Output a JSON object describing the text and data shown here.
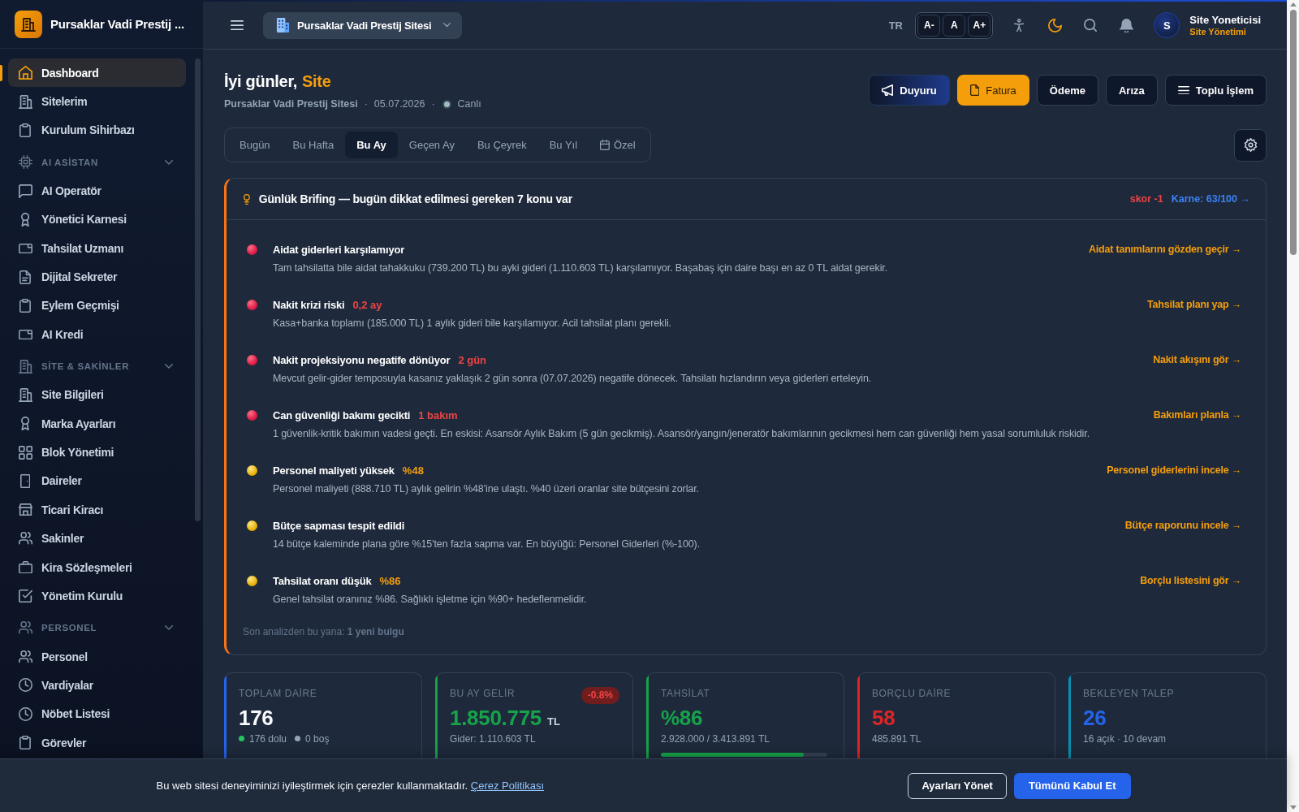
{
  "sidebar": {
    "brand": "Pursaklar Vadi Prestij ...",
    "nav": [
      {
        "kind": "link",
        "label": "Dashboard",
        "selected": true
      },
      {
        "kind": "link",
        "label": "Sitelerim",
        "selected": false
      },
      {
        "kind": "link",
        "label": "Kurulum Sihirbazı",
        "selected": false
      },
      {
        "kind": "group",
        "label": "AI ASİSTAN",
        "expanded": true,
        "children": [
          {
            "label": "AI Operatör",
            "selected": false
          },
          {
            "label": "Yönetici Karnesi",
            "selected": false
          },
          {
            "label": "Tahsilat Uzmanı",
            "selected": false
          },
          {
            "label": "Dijital Sekreter",
            "selected": false
          },
          {
            "label": "Eylem Geçmişi",
            "selected": false
          },
          {
            "label": "AI Kredi",
            "selected": false
          }
        ]
      },
      {
        "kind": "group",
        "label": "SİTE & SAKİNLER",
        "expanded": true,
        "children": [
          {
            "label": "Site Bilgileri",
            "selected": false
          },
          {
            "label": "Marka Ayarları",
            "selected": false
          },
          {
            "label": "Blok Yönetimi",
            "selected": false
          },
          {
            "label": "Daireler",
            "selected": false
          },
          {
            "label": "Ticari Kiracı",
            "selected": false
          },
          {
            "label": "Sakinler",
            "selected": false
          },
          {
            "label": "Kira Sözleşmeleri",
            "selected": false
          },
          {
            "label": "Yönetim Kurulu",
            "selected": false
          }
        ]
      },
      {
        "kind": "group",
        "label": "PERSONEL",
        "expanded": true,
        "children": [
          {
            "label": "Personel",
            "selected": false
          },
          {
            "label": "Vardiyalar",
            "selected": false
          },
          {
            "label": "Nöbet Listesi",
            "selected": false
          },
          {
            "label": "Görevler",
            "selected": false
          }
        ]
      }
    ]
  },
  "topbar": {
    "site_selector": "Pursaklar Vadi Prestij Sitesi",
    "language": "TR",
    "font_sizes": [
      "A-",
      "A",
      "A+"
    ],
    "user": {
      "initial": "S",
      "name": "Site Yoneticisi",
      "role": "Site Yönetimi"
    }
  },
  "page": {
    "greeting": "İyi günler,",
    "greeting_name": "Site",
    "meta": [
      {
        "kind": "site",
        "text": "Pursaklar Vadi Prestij Sitesi"
      },
      {
        "kind": "separator",
        "text": "·"
      },
      {
        "kind": "date",
        "text": "05.07.2026"
      },
      {
        "kind": "separator",
        "text": "·"
      },
      {
        "kind": "status",
        "text": "Canlı"
      }
    ],
    "actions": [
      {
        "label": "Duyuru",
        "kind": "accent"
      },
      {
        "label": "Fatura",
        "kind": "primary"
      },
      {
        "label": "Ödeme",
        "kind": "default"
      },
      {
        "label": "Arıza",
        "kind": "default"
      },
      {
        "label": "Toplu İşlem",
        "kind": "default"
      }
    ],
    "periods": [
      {
        "label": "Bugün",
        "selected": false
      },
      {
        "label": "Bu Hafta",
        "selected": false
      },
      {
        "label": "Bu Ay",
        "selected": true
      },
      {
        "label": "Geçen Ay",
        "selected": false
      },
      {
        "label": "Bu Çeyrek",
        "selected": false
      },
      {
        "label": "Bu Yıl",
        "selected": false
      },
      {
        "label": "Özel",
        "selected": false
      }
    ]
  },
  "briefing": {
    "title": "Günlük Brifing — bugün dikkat edilmesi gereken 7 konu var",
    "score": "skor -1",
    "report_card_link": "Karne: 63/100 →",
    "items": [
      {
        "kind": "critical",
        "title": "Aidat giderleri karşılamıyor",
        "description": "Tam tahsilatta bile aidat tahakkuku (739.200 TL) bu ayki gideri (1.110.603 TL) karşılamıyor. Başabaş için daire başı en az 0 TL aidat gerekir.",
        "action": "Aidat tanımlarını gözden geçir →"
      },
      {
        "kind": "critical",
        "title": "Nakit krizi riski",
        "tag": "0,2 ay",
        "description": "Kasa+banka toplamı (185.000 TL) 1 aylık gideri bile karşılamıyor. Acil tahsilat planı gerekli.",
        "action": "Tahsilat planı yap →"
      },
      {
        "kind": "critical",
        "title": "Nakit projeksiyonu negatife dönüyor",
        "tag": "2 gün",
        "description": "Mevcut gelir-gider temposuyla kasanız yaklaşık 2 gün sonra (07.07.2026) negatife dönecek. Tahsilatı hızlandırın veya giderleri erteleyin.",
        "action": "Nakit akışını gör →"
      },
      {
        "kind": "critical",
        "title": "Can güvenliği bakımı gecikti",
        "tag": "1 bakım",
        "description": "1 güvenlik-kritik bakımın vadesi geçti. En eskisi: Asansör Aylık Bakım (5 gün gecikmiş). Asansör/yangın/jeneratör bakımlarının gecikmesi hem can güvenliği hem yasal sorumluluk riskidir.",
        "action": "Bakımları planla →"
      },
      {
        "kind": "warning",
        "title": "Personel maliyeti yüksek",
        "tag": "%48",
        "description": "Personel maliyeti (888.710 TL) aylık gelirin %48'ine ulaştı. %40 üzeri oranlar site bütçesini zorlar.",
        "action": "Personel giderlerini incele →"
      },
      {
        "kind": "warning",
        "title": "Bütçe sapması tespit edildi",
        "description": "14 bütçe kaleminde plana göre %15'ten fazla sapma var. En büyüğü: Personel Giderleri (%-100).",
        "action": "Bütçe raporunu incele →"
      },
      {
        "kind": "warning",
        "title": "Tahsilat oranı düşük",
        "tag": "%86",
        "description": "Genel tahsilat oranınız %86. Sağlıklı işletme için %90+ hedeflenmelidir.",
        "action": "Borçlu listesini gör →"
      }
    ],
    "footer": "Son analizden bu yana: **1 yeni bulgu**"
  },
  "stats": [
    {
      "label": "TOPLAM DAİRE",
      "value": {
        "text": "176",
        "color": "#f8fafc"
      },
      "color": "#2563eb",
      "legend": [
        {
          "text": "176 dolu",
          "color": "#22c55e"
        },
        {
          "text": "0 boş",
          "color": "#94a3b8"
        }
      ]
    },
    {
      "label": "BU AY GELİR",
      "value": {
        "text": "1.850.775",
        "color": "#16a34a"
      },
      "unit": "TL",
      "badge": "-0.8%",
      "color": "#16a34a",
      "sub": "Gider: 1.110.603 TL"
    },
    {
      "label": "TAHSİLAT",
      "value": {
        "text": "%86",
        "color": "#16a34a"
      },
      "color": "#16a34a",
      "sub": "2.928.000 / 3.413.891 TL",
      "level": 0.86
    },
    {
      "label": "BORÇLU DAİRE",
      "value": {
        "text": "58",
        "color": "#dc2626"
      },
      "color": "#dc2626",
      "sub": "485.891 TL"
    },
    {
      "label": "BEKLEYEN TALEP",
      "value": {
        "text": "26",
        "color": "#2563eb"
      },
      "color": "#0891b2",
      "sub": "16 açık · 10 devam"
    }
  ],
  "cookie_banner": {
    "text": "Bu web sitesi deneyiminizi iyileştirmek için çerezler kullanmaktadır.",
    "link": "Çerez Politikası",
    "buttons": [
      {
        "label": "Ayarları Yönet",
        "kind": "outline"
      },
      {
        "label": "Tümünü Kabul Et",
        "kind": "primary"
      }
    ]
  }
}
